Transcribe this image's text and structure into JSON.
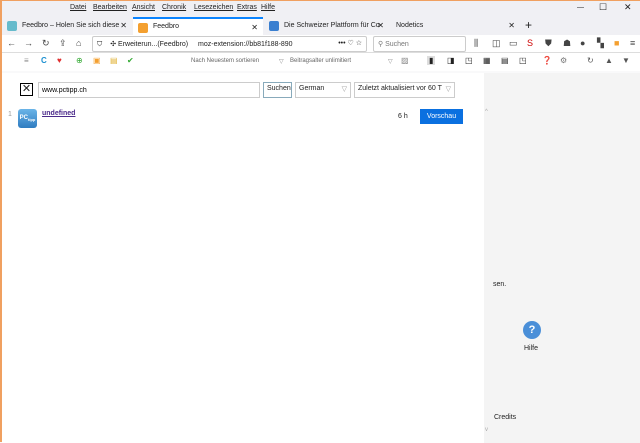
{
  "menu": [
    "Datei",
    "Bearbeiten",
    "Ansicht",
    "Chronik",
    "Lesezeichen",
    "Extras",
    "Hilfe"
  ],
  "tabs": [
    {
      "label": "Feedbro – Holen Sie sich diese"
    },
    {
      "label": "Feedbro"
    },
    {
      "label": "Die Schweizer Plattform für Co"
    },
    {
      "label": "Nodetics"
    }
  ],
  "url": {
    "identity": "Erweiterun...(Feedbro)",
    "address": "moz-extension://bb81f188-890"
  },
  "search_placeholder": "Suchen",
  "toolbar": {
    "sort": "Nach Neuestem sortieren",
    "age": "Beitragsalter unlimitiert"
  },
  "finder": {
    "query": "www.pctipp.ch",
    "search_button": "Suchen",
    "language": "German",
    "updated": "Zuletzt aktualisiert vor 60 T"
  },
  "result": {
    "index": "1",
    "title": "undefined",
    "age": "6 h",
    "preview_button": "Vorschau",
    "logo": "PCtipp"
  },
  "side": {
    "text": "sen.",
    "help": "Hilfe",
    "credits": "Credits"
  },
  "colors": {
    "accent": "#0a70e0",
    "tab_accent": "#0a84ff"
  }
}
